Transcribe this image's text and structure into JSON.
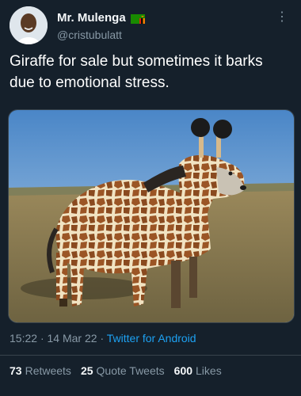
{
  "author": {
    "name": "Mr. Mulenga",
    "handle": "@cristubulatt",
    "flag_icon": "zambia-flag-icon"
  },
  "tweet": {
    "text": "Giraffe for sale but sometimes it barks due to emotional stress.",
    "time": "15:22",
    "date": "14 Mar 22",
    "separator": "·",
    "source": "Twitter for Android"
  },
  "stats": {
    "retweets_count": "73",
    "retweets_label": "Retweets",
    "quotes_count": "25",
    "quotes_label": "Quote Tweets",
    "likes_count": "600",
    "likes_label": "Likes"
  },
  "icons": {
    "more": "more-options-icon"
  },
  "colors": {
    "background": "#15202b",
    "text_primary": "#ffffff",
    "text_secondary": "#8899a6",
    "link": "#1da1f2"
  }
}
